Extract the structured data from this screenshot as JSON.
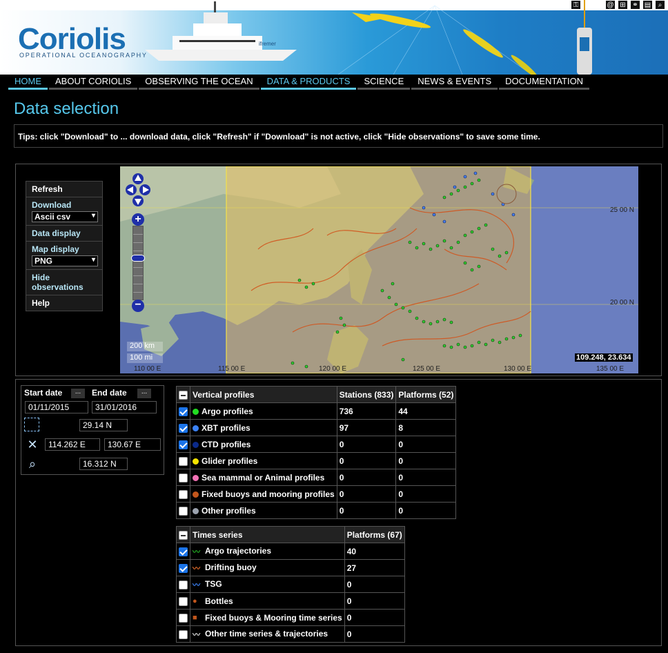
{
  "header": {
    "logo": "Coriolis",
    "logo_sub": "OPERATIONAL OCEANOGRAPHY",
    "ship_label": "ifremer",
    "util_icons": [
      "key-icon",
      "at-icon",
      "sitemap-icon",
      "link-icon",
      "print-icon",
      "search-icon"
    ]
  },
  "nav": {
    "items": [
      "HOME",
      "ABOUT CORIOLIS",
      "OBSERVING THE OCEAN",
      "DATA & PRODUCTS",
      "SCIENCE",
      "NEWS & EVENTS",
      "DOCUMENTATION"
    ],
    "active": [
      "HOME",
      "DATA & PRODUCTS"
    ]
  },
  "page": {
    "title": "Data selection",
    "tips": "Tips: click \"Download\" to ... download data, click \"Refresh\" if \"Download\" is not active, click \"Hide observations\" to save some time."
  },
  "side_menu": {
    "refresh": "Refresh",
    "download": "Download",
    "download_format": "Ascii csv",
    "data_display": "Data display",
    "map_display": "Map display",
    "map_format": "PNG",
    "hide_obs": "Hide observations",
    "help": "Help"
  },
  "map": {
    "coord_readout": "109.248, 23.634",
    "scale_km": "200 km",
    "scale_mi": "100 mi",
    "lon_labels": [
      "110 00 E",
      "115 00 E",
      "120 00 E",
      "125 00 E",
      "130 00 E",
      "135 00 E"
    ],
    "lat_labels": [
      "25 00 N",
      "20 00 N"
    ]
  },
  "dates": {
    "start_label": "Start date",
    "end_label": "End date",
    "picker": "...",
    "start_value": "01/11/2015",
    "end_value": "31/01/2016",
    "north": "29.14 N",
    "west": "114.262 E",
    "east": "130.67 E",
    "south": "16.312 N"
  },
  "vertical_profiles": {
    "header": "Vertical profiles",
    "stations_header": "Stations (833)",
    "platforms_header": "Platforms (52)",
    "rows": [
      {
        "label": "Argo profiles",
        "stations": "736",
        "platforms": "44",
        "checked": true,
        "color": "#22dd22"
      },
      {
        "label": "XBT profiles",
        "stations": "97",
        "platforms": "8",
        "checked": true,
        "color": "#3b82f6"
      },
      {
        "label": "CTD profiles",
        "stations": "0",
        "platforms": "0",
        "checked": true,
        "color": "#0b2a8a"
      },
      {
        "label": "Glider profiles",
        "stations": "0",
        "platforms": "0",
        "checked": false,
        "color": "#f5e400"
      },
      {
        "label": "Sea mammal or Animal profiles",
        "stations": "0",
        "platforms": "0",
        "checked": false,
        "color": "#f472b6"
      },
      {
        "label": "Fixed buoys and mooring profiles",
        "stations": "0",
        "platforms": "0",
        "checked": false,
        "color": "#c2561c"
      },
      {
        "label": "Other profiles",
        "stations": "0",
        "platforms": "0",
        "checked": false,
        "color": "#9ca3af"
      }
    ]
  },
  "time_series": {
    "header": "Times series",
    "platforms_header": "Platforms (67)",
    "rows": [
      {
        "label": "Argo trajectories",
        "platforms": "40",
        "checked": true,
        "color": "#22aa22"
      },
      {
        "label": "Drifting buoy",
        "platforms": "27",
        "checked": true,
        "color": "#e06a2a"
      },
      {
        "label": "TSG",
        "platforms": "0",
        "checked": false,
        "color": "#3b82f6"
      },
      {
        "label": "Bottles",
        "platforms": "0",
        "checked": false,
        "color": "#c2561c"
      },
      {
        "label": "Fixed buoys & Mooring time series",
        "platforms": "0",
        "checked": false,
        "color": "#c2561c"
      },
      {
        "label": "Other time series & trajectories",
        "platforms": "0",
        "checked": false,
        "color": "#dddddd"
      }
    ]
  }
}
